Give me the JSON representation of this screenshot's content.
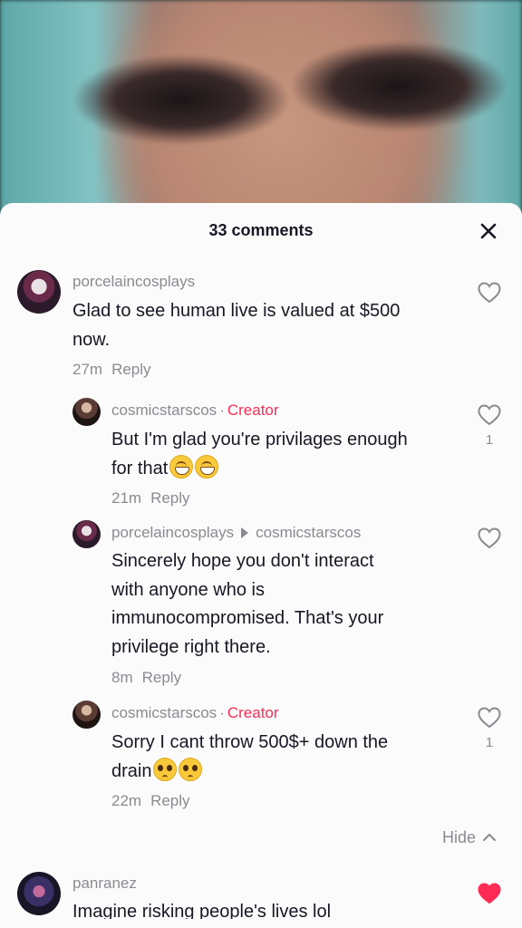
{
  "panel": {
    "title": "33 comments"
  },
  "comments": [
    {
      "username": "porcelaincosplays",
      "text": "Glad to see human live is valued at $500 now.",
      "text_line1": "Glad to see human live is valued at $500",
      "text_line2": "now.",
      "time": "27m",
      "reply_label": "Reply",
      "liked": false,
      "like_count": ""
    },
    {
      "username": "cosmicstarscos",
      "badge": "Creator",
      "separator": "·",
      "text_line1": "But I'm glad you're privilages enough",
      "text_line2": "for that",
      "emojis": [
        "grinning-face",
        "grinning-face"
      ],
      "time": "21m",
      "reply_label": "Reply",
      "liked": false,
      "like_count": "1"
    },
    {
      "username": "porcelaincosplays",
      "reply_to": "cosmicstarscos",
      "text_line1": "Sincerely hope you don't interact",
      "text_line2": "with anyone who is",
      "text_line3": "immunocompromised. That's your",
      "text_line4": "privilege right there.",
      "time": "8m",
      "reply_label": "Reply",
      "liked": false,
      "like_count": ""
    },
    {
      "username": "cosmicstarscos",
      "badge": "Creator",
      "separator": "·",
      "text_line1": "Sorry I cant throw 500$+ down the",
      "text_line2": "drain",
      "emojis": [
        "pleading-face",
        "pleading-face"
      ],
      "time": "22m",
      "reply_label": "Reply",
      "liked": false,
      "like_count": "1"
    },
    {
      "username": "panranez",
      "text_line1": "Imagine risking people's lives lol",
      "liked": true,
      "like_count": ""
    }
  ],
  "hide_label": "Hide",
  "colors": {
    "accent": "#fe2c55",
    "muted": "#8a8b91",
    "text": "#161823"
  }
}
